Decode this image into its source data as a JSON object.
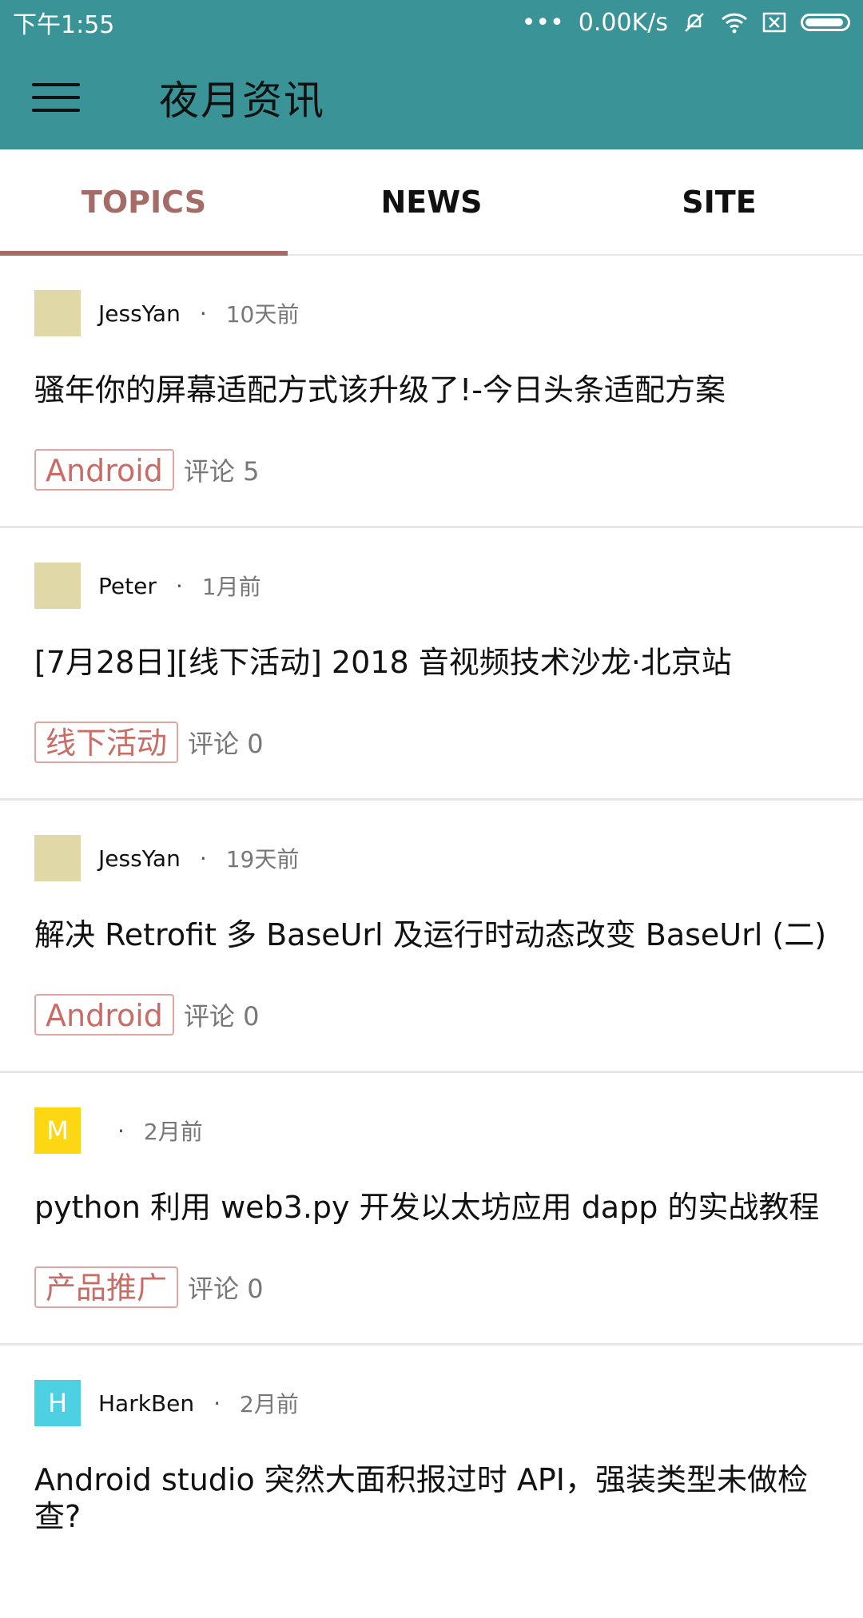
{
  "status_bar": {
    "time": "下午1:55",
    "signal_dots": "•••",
    "speed": "0.00K/s",
    "icons": [
      "dots-icon",
      "mute-icon",
      "wifi-icon",
      "sim-x-icon",
      "battery-icon"
    ]
  },
  "app_bar": {
    "title": "夜月资讯",
    "menu_icon": "hamburger-icon"
  },
  "tabs": [
    {
      "label": "TOPICS",
      "active": true
    },
    {
      "label": "NEWS",
      "active": false
    },
    {
      "label": "SITE",
      "active": false
    }
  ],
  "topics": [
    {
      "author": "JessYan",
      "dot": "·",
      "time": "10天前",
      "title": "骚年你的屏幕适配方式该升级了!-今日头条适配方案",
      "tag": "Android",
      "comments": "评论 5",
      "avatar_letter": "",
      "avatar_color": "#e1d8a8"
    },
    {
      "author": "Peter",
      "dot": "·",
      "time": "1月前",
      "title": "[7月28日][线下活动] 2018 音视频技术沙龙·北京站",
      "tag": "线下活动",
      "comments": "评论 0",
      "avatar_letter": "",
      "avatar_color": "#e1d8a8"
    },
    {
      "author": "JessYan",
      "dot": "·",
      "time": "19天前",
      "title": "解决 Retrofit 多 BaseUrl 及运行时动态改变 BaseUrl (二)",
      "tag": "Android",
      "comments": "评论 0",
      "avatar_letter": "",
      "avatar_color": "#e1d8a8"
    },
    {
      "author": "",
      "dot": "·",
      "time": "2月前",
      "title": "python 利用 web3.py 开发以太坊应用 dapp 的实战教程",
      "tag": "产品推广",
      "comments": "评论 0",
      "avatar_letter": "M",
      "avatar_color": "#fdd614"
    },
    {
      "author": "HarkBen",
      "dot": "·",
      "time": "2月前",
      "title": "Android studio 突然大面积报过时 API，强装类型未做检查?",
      "tag": "",
      "comments": "",
      "avatar_letter": "H",
      "avatar_color": "#4dd0e1"
    }
  ]
}
